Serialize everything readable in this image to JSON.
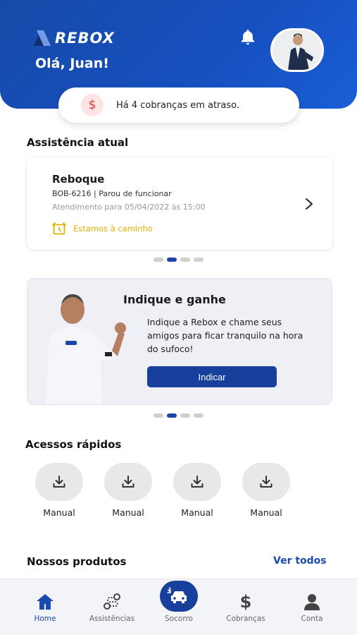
{
  "header": {
    "logo_text": "REBOX",
    "greeting": "Olá, Juan!"
  },
  "alert": {
    "icon": "dollar-icon",
    "text": "Há 4 cobranças em atraso."
  },
  "assistance": {
    "section_title": "Assistência atual",
    "type": "Reboque",
    "plate_problem": "BOB-6216 | Parou de funcionar",
    "schedule": "Atendimento para 05/04/2022 às 15:00",
    "status": "Estamos à caminho",
    "carousel_active": 2,
    "carousel_count": 4
  },
  "promo": {
    "title": "Indique e ganhe",
    "text": "Indique a Rebox e chame seus amigos para ficar tranquilo na hora do sufoco!",
    "button": "Indicar",
    "carousel_active": 2,
    "carousel_count": 4
  },
  "quick_access": {
    "section_title": "Acessos rápidos",
    "items": [
      {
        "label": "Manual",
        "icon": "download-icon"
      },
      {
        "label": "Manual",
        "icon": "download-icon"
      },
      {
        "label": "Manual",
        "icon": "download-icon"
      },
      {
        "label": "Manual",
        "icon": "download-icon"
      }
    ]
  },
  "products": {
    "section_title": "Nossos produtos",
    "see_all": "Ver todos"
  },
  "nav": {
    "items": [
      {
        "label": "Home",
        "icon": "home-icon",
        "active": true
      },
      {
        "label": "Assistências",
        "icon": "route-icon",
        "active": false
      },
      {
        "label": "Socorro",
        "icon": "car-crash-icon",
        "active": false
      },
      {
        "label": "Cobranças",
        "icon": "dollar-icon",
        "active": false
      },
      {
        "label": "Conta",
        "icon": "user-icon",
        "active": false
      }
    ]
  },
  "colors": {
    "primary": "#1a4bb0",
    "status_yellow": "#e0b000",
    "alert_red": "#d14040"
  }
}
